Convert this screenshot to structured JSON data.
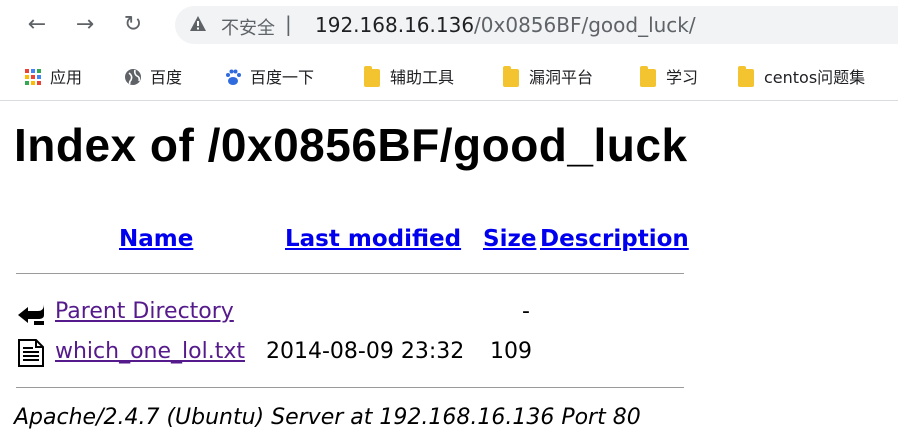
{
  "browser": {
    "back_icon": "←",
    "forward_icon": "→",
    "reload_icon": "↻",
    "security_label": "不安全",
    "separator": "|",
    "url_host": "192.168.16.136",
    "url_path": "/0x0856BF/good_luck/"
  },
  "bookmarks": [
    {
      "label": "应用",
      "icon": "apps-grid-icon"
    },
    {
      "label": "百度",
      "icon": "globe-icon"
    },
    {
      "label": "百度一下",
      "icon": "baidu-paw-icon"
    },
    {
      "label": "辅助工具",
      "icon": "folder-icon"
    },
    {
      "label": "漏洞平台",
      "icon": "folder-icon"
    },
    {
      "label": "学习",
      "icon": "folder-icon"
    },
    {
      "label": "centos问题集",
      "icon": "folder-icon"
    }
  ],
  "page": {
    "title": "Index of /0x0856BF/good_luck",
    "columns": {
      "name": "Name",
      "last_modified": "Last modified",
      "size": "Size",
      "description": "Description"
    },
    "rows": [
      {
        "name": "Parent Directory",
        "modified": "",
        "size": "-",
        "icon": "back-arrow-icon"
      },
      {
        "name": "which_one_lol.txt",
        "modified": "2014-08-09 23:32",
        "size": "109",
        "icon": "text-file-icon"
      }
    ],
    "footer": "Apache/2.4.7 (Ubuntu) Server at 192.168.16.136 Port 80"
  }
}
